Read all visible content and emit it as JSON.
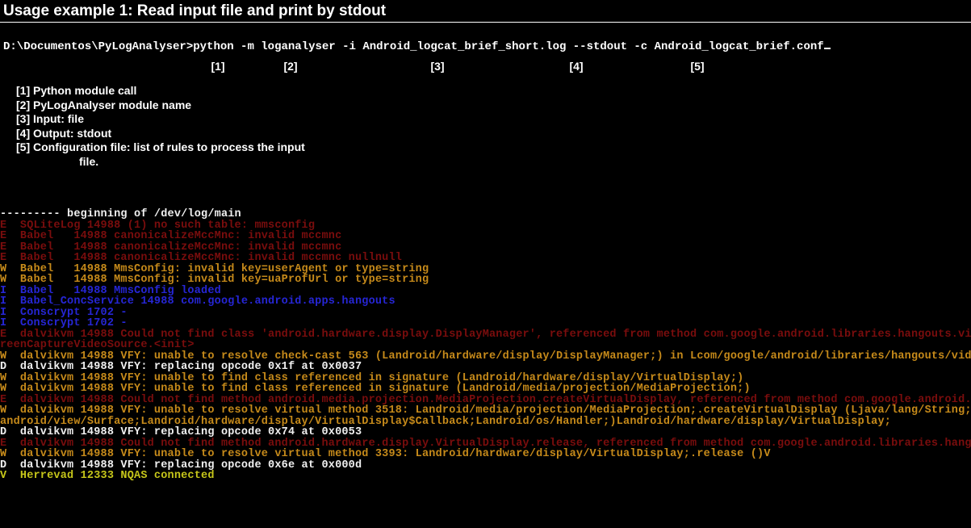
{
  "title": "Usage example 1: Read input file and print by stdout",
  "cmd": {
    "prompt": "D:\\Documentos\\PyLogAnalyser>",
    "p1": "python -m",
    "p2": "loganalyser",
    "p3_flag": "-i",
    "p3_val": "Android_logcat_brief_short.log",
    "p4": "--stdout",
    "p5_flag": "-c",
    "p5_val": "Android_logcat_brief.conf"
  },
  "annot": {
    "a1": "[1]",
    "a2": "[2]",
    "a3": "[3]",
    "a4": "[4]",
    "a5": "[5]"
  },
  "legend": {
    "l1": "[1] Python module call",
    "l2": "[2] PyLogAnalyser module name",
    "l3": "[3] Input: file",
    "l4": "[4] Output: stdout",
    "l5": "[5] Configuration file: list of rules to process the input",
    "l5b": "file."
  },
  "log": [
    {
      "cls": "c-white",
      "t": "--------- beginning of /dev/log/main"
    },
    {
      "cls": "c-red",
      "t": "E  SQLiteLog 14988 (1) no such table: mmsconfig"
    },
    {
      "cls": "c-red",
      "t": "E  Babel   14988 canonicalizeMccMnc: invalid mccmnc "
    },
    {
      "cls": "c-red",
      "t": "E  Babel   14988 canonicalizeMccMnc: invalid mccmnc "
    },
    {
      "cls": "c-red",
      "t": "E  Babel   14988 canonicalizeMccMnc: invalid mccmnc nullnull"
    },
    {
      "cls": "c-orange",
      "t": "W  Babel   14988 MmsConfig: invalid key=userAgent or type=string"
    },
    {
      "cls": "c-orange",
      "t": "W  Babel   14988 MmsConfig: invalid key=uaProfUrl or type=string"
    },
    {
      "cls": "c-blue",
      "t": "I  Babel   14988 MmsConfig loaded"
    },
    {
      "cls": "c-blue",
      "t": "I  Babel_ConcService 14988 com.google.android.apps.hangouts"
    },
    {
      "cls": "c-blue",
      "t": "I  Conscrypt 1702 -   "
    },
    {
      "cls": "c-blue",
      "t": "I  Conscrypt 1702 -   "
    },
    {
      "cls": "c-red",
      "t": "E  dalvikvm 14988 Could not find class 'android.hardware.display.DisplayManager', referenced from method com.google.android.libraries.hangouts.video.Sc"
    },
    {
      "cls": "c-red",
      "t": "reenCaptureVideoSource.<init>"
    },
    {
      "cls": "c-orange",
      "t": "W  dalvikvm 14988 VFY: unable to resolve check-cast 563 (Landroid/hardware/display/DisplayManager;) in Lcom/google/android/libraries/hangouts/video/Sc"
    },
    {
      "cls": "c-white",
      "t": "D  dalvikvm 14988 VFY: replacing opcode 0x1f at 0x0037"
    },
    {
      "cls": "c-orange",
      "t": "W  dalvikvm 14988 VFY: unable to find class referenced in signature (Landroid/hardware/display/VirtualDisplay;)"
    },
    {
      "cls": "c-orange",
      "t": "W  dalvikvm 14988 VFY: unable to find class referenced in signature (Landroid/media/projection/MediaProjection;)"
    },
    {
      "cls": "c-red",
      "t": "E  dalvikvm 14988 Could not find method android.media.projection.MediaProjection.createVirtualDisplay, referenced from method com.google.android.libra"
    },
    {
      "cls": "c-orange",
      "t": "W  dalvikvm 14988 VFY: unable to resolve virtual method 3518: Landroid/media/projection/MediaProjection;.createVirtualDisplay (Ljava/lang/String;IIIIL"
    },
    {
      "cls": "c-orange",
      "t": "android/view/Surface;Landroid/hardware/display/VirtualDisplay$Callback;Landroid/os/Handler;)Landroid/hardware/display/VirtualDisplay;"
    },
    {
      "cls": "c-white",
      "t": "D  dalvikvm 14988 VFY: replacing opcode 0x74 at 0x0053"
    },
    {
      "cls": "c-red",
      "t": "E  dalvikvm 14988 Could not find method android.hardware.display.VirtualDisplay.release, referenced from method com.google.android.libraries.hangouts"
    },
    {
      "cls": "c-orange",
      "t": "W  dalvikvm 14988 VFY: unable to resolve virtual method 3393: Landroid/hardware/display/VirtualDisplay;.release ()V"
    },
    {
      "cls": "c-white",
      "t": "D  dalvikvm 14988 VFY: replacing opcode 0x6e at 0x000d"
    },
    {
      "cls": "c-yellow",
      "t": "V  Herrevad 12333 NQAS connected"
    }
  ]
}
